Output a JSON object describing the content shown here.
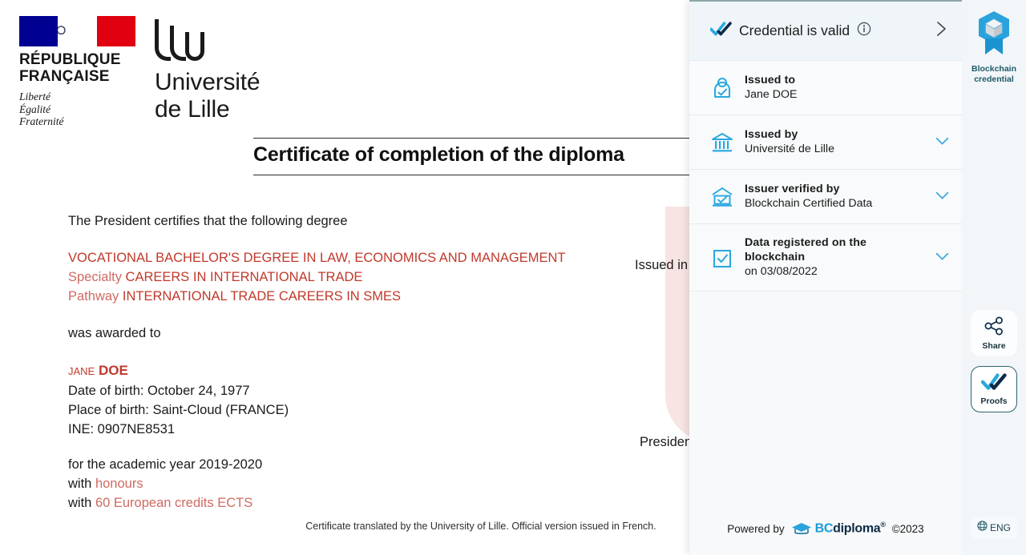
{
  "certificate": {
    "republic": {
      "title": "RÉPUBLIQUE\nFRANÇAISE",
      "title_line1": "RÉPUBLIQUE",
      "title_line2": "FRANÇAISE",
      "motto_line1": "Liberté",
      "motto_line2": "Égalité",
      "motto_line3": "Fraternité"
    },
    "university": {
      "name_line1": "Université",
      "name_line2": "de Lille"
    },
    "title": "Certificate of completion of the diploma",
    "intro": "The President certifies that the following degree",
    "degree": {
      "main": "VOCATIONAL BACHELOR'S DEGREE IN LAW, ECONOMICS AND MANAGEMENT",
      "specialty_label": "Specialty",
      "specialty_value": "CAREERS IN INTERNATIONAL TRADE",
      "pathway_label": "Pathway",
      "pathway_value": "INTERNATIONAL TRADE CAREERS IN SMES"
    },
    "awarded_to_label": "was awarded to",
    "recipient": {
      "first_name": "Jane",
      "last_name": "DOE",
      "date_of_birth": "Date of birth: October 24, 1977",
      "place_of_birth": "Place of birth: Saint-Cloud (FRANCE)",
      "ine": "INE: 0907NE8531"
    },
    "academic_year": "for the academic year 2019-2020",
    "honours_label": "with",
    "honours_value": "honours",
    "credits_label": "with",
    "credits_value": "60 European credits ECTS",
    "issued_in": "Issued in",
    "president": "President",
    "footnote": "Certificate translated by the University of Lille. Official version issued in French."
  },
  "panel": {
    "header": {
      "title": "Credential is valid",
      "info_icon": "info-circle-icon",
      "valid_icon": "double-check-icon",
      "expand_icon": "chevron-right-icon"
    },
    "rows": [
      {
        "icon": "person-verified-icon",
        "label": "Issued to",
        "value": "Jane DOE",
        "has_chevron": false
      },
      {
        "icon": "institution-icon",
        "label": "Issued by",
        "value": "Université de Lille",
        "has_chevron": true
      },
      {
        "icon": "institution-verified-icon",
        "label": "Issuer verified by",
        "value": "Blockchain Certified Data",
        "has_chevron": true
      },
      {
        "icon": "checkbox-icon",
        "label": "Data registered on the blockchain",
        "value": " on 03/08/2022",
        "has_chevron": true
      }
    ],
    "footer": {
      "powered_by": "Powered by",
      "brand_prefix": "BC",
      "brand_suffix": "diploma",
      "brand_registered": "®",
      "copyright": "©2023",
      "logo_icon": "graduation-cap-icon"
    }
  },
  "rail": {
    "badge": {
      "icon": "blockchain-badge-icon",
      "caption_line1": "Blockchain",
      "caption_line2": "credential"
    },
    "buttons": [
      {
        "icon": "share-icon",
        "label": "Share",
        "selected": false
      },
      {
        "icon": "double-check-icon",
        "label": "Proofs",
        "selected": true
      }
    ],
    "language": {
      "icon": "globe-icon",
      "label": "ENG"
    }
  },
  "colors": {
    "accent_blue": "#29a8e0",
    "dark_navy": "#0d2b45",
    "certificate_red": "#c0392b",
    "teal": "#2b6470",
    "panel_bg": "#f7f9fa"
  }
}
